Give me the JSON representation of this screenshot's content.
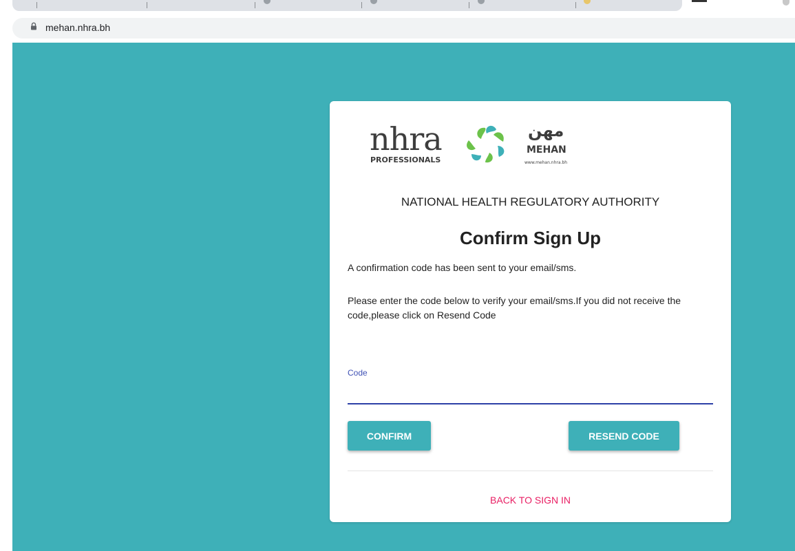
{
  "browser": {
    "url": "mehan.nhra.bh",
    "lock_icon": "lock-icon"
  },
  "colors": {
    "page_background": "#3eb0b8",
    "button_background": "#3eb0b8",
    "input_underline": "#2b3fa6",
    "link": "#e91e63",
    "label": "#3f51b5"
  },
  "logo": {
    "left_word": "nhra",
    "left_subtitle": "PROFESSIONALS",
    "right_arabic": "مهن",
    "right_word": "MEHAN",
    "right_url": "www.mehan.nhra.bh"
  },
  "card": {
    "authority": "NATIONAL HEALTH REGULATORY AUTHORITY",
    "title": "Confirm Sign Up",
    "message_sent": "A confirmation code has been sent to your email/sms.",
    "message_instructions": "Please enter the code below to verify your email/sms.If you did not receive the code,please click on Resend Code",
    "code_label": "Code",
    "code_value": "",
    "confirm_label": "CONFIRM",
    "resend_label": "RESEND CODE",
    "back_label": "BACK TO SIGN IN"
  }
}
